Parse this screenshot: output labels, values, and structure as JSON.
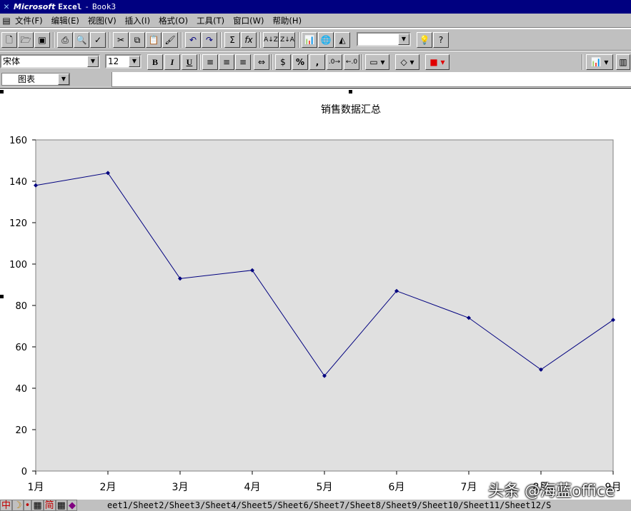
{
  "window": {
    "app_name": "Microsoft",
    "app_name_bold": "Excel",
    "separator": "-",
    "doc_title": "Book3"
  },
  "menu": [
    "文件(F)",
    "编辑(E)",
    "视图(V)",
    "插入(I)",
    "格式(O)",
    "工具(T)",
    "窗口(W)",
    "帮助(H)"
  ],
  "toolbar": {
    "font_name": "宋体",
    "font_size": "12",
    "bold": "B",
    "italic": "I",
    "underline": "U",
    "percent": "%",
    "comma": ",",
    "sum": "Σ",
    "fx": "fx"
  },
  "name_box": "图表",
  "chart_data": {
    "type": "line",
    "title": "销售数据汇总",
    "categories": [
      "1月",
      "2月",
      "3月",
      "4月",
      "5月",
      "6月",
      "7月",
      "8月",
      "9月"
    ],
    "series": [
      {
        "values": [
          138,
          144,
          93,
          97,
          46,
          87,
          74,
          49,
          73
        ],
        "color": "#00007f"
      }
    ],
    "ylim": [
      0,
      160
    ],
    "yticks": [
      0,
      20,
      40,
      60,
      80,
      100,
      120,
      140,
      160
    ],
    "plot_background": "#e0e0e0",
    "legend": "none",
    "grid": false
  },
  "ime_bar": [
    "中",
    "☽",
    "•",
    "▦",
    "简",
    "▦"
  ],
  "sheet_tabs": [
    "eet1",
    "Sheet2",
    "Sheet3",
    "Sheet4",
    "Sheet5",
    "Sheet6",
    "Sheet7",
    "Sheet8",
    "Sheet9",
    "Sheet10",
    "Sheet11",
    "Sheet12",
    "S"
  ],
  "watermark": "头条 @海蓝office"
}
